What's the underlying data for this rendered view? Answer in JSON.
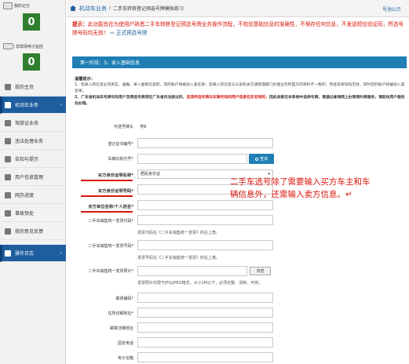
{
  "sidebar": {
    "widgets": [
      {
        "title": "我的记分",
        "value": "0",
        "icon": "scorecard-icon"
      },
      {
        "title": "非现场电子监控",
        "value": "0",
        "icon": "camera-icon"
      }
    ],
    "items": [
      {
        "label": "我的主页",
        "icon": "home-icon"
      },
      {
        "label": "机动车业务",
        "icon": "car-icon",
        "active": true
      },
      {
        "label": "驾驶证业务",
        "icon": "license-icon"
      },
      {
        "label": "违法处理业务",
        "icon": "violation-icon"
      },
      {
        "label": "告知与提示",
        "icon": "bell-icon"
      },
      {
        "label": "用户信息管理",
        "icon": "user-icon"
      },
      {
        "label": "网办进度",
        "icon": "progress-icon"
      },
      {
        "label": "事故快处",
        "icon": "accident-icon"
      },
      {
        "label": "我的意见反馈",
        "icon": "feedback-icon"
      },
      {
        "label": "操作日志",
        "icon": "log-icon",
        "active": true
      }
    ]
  },
  "header": {
    "section": "机动车业务",
    "separator": "/",
    "page": "二手车转移登记预选号牌模拟练习",
    "notice": "号池公示"
  },
  "tip": {
    "label": "提示：",
    "text": "此功能旨在为使用户熟悉二手车转移登记预选号牌业务操作流程，不校验基础信息的准确性，不保存任何信息，不发送短信验证码，所选号牌号码均无效！",
    "link": "正式预选号牌"
  },
  "stage": "第一阶段：3、录入基础信息",
  "reminder": {
    "title": "温馨提示：",
    "line1": "1、您录入的信息必须真实、准确，录入虚假信息的，您的账户将被加入黑名单；您录入的信息与公安机关交通管理部门办理业务时提交的资料不一致的，所选号牌号码无效，同时您的账户将被加入黑名单。",
    "line2_a": "2、",
    "line2_b": "广东省机动车号牌号码用户及预选号牌须在广东省内注册过的，",
    "line2_red": "且须所选号牌与车辆号码的用户信息在实名制的，",
    "line2_c": "因此未能在本系统中选择号牌，请通过查询网上办理预约等服务，请前往用户服务处办理。"
  },
  "form": {
    "province_label": "可选号牌头",
    "province_value": "粤B",
    "cert_label": "登记证书编号*",
    "vin_label": "车辆识别代号*",
    "query_button": "查询",
    "buyer_id_type_label": "买方身份证明名称*",
    "buyer_id_type_value": "居民身份证",
    "buyer_id_no_label": "买方身份证明号码*",
    "buyer_name_label": "买方单位名称/个人姓名*",
    "invoice_code_label": "二手车销售统一发票代码*",
    "invoice_code_hint": "发票代码在《二手车销售统一发票》的右上角。",
    "invoice_no_label": "二手车销售统一发票号码*",
    "invoice_no_hint": "发票号码在《二手车销售统一发票》的右上角。",
    "invoice_photo_label": "二手车销售统一发票照片*",
    "browse_button": "浏览",
    "invoice_photo_hint": "发票照片仅限于JPG/JPEG格式，大小1M以下，必须完整、清晰、可辨。",
    "postal_label": "邮政编码*",
    "address_label": "住所详细地址*",
    "mail_address_label": "邮寄详细地址",
    "phone_label": "固定电话",
    "email_label": "电子信箱"
  },
  "annotation": "二手车选号除了需要输入买方车主和车辆信息外，还需输入卖方信息。↵",
  "colors": {
    "brand_blue": "#1f5e9e",
    "stage_blue": "#1f7fb5",
    "warning_red": "#d8140c",
    "score_green": "#2f7f2f"
  }
}
